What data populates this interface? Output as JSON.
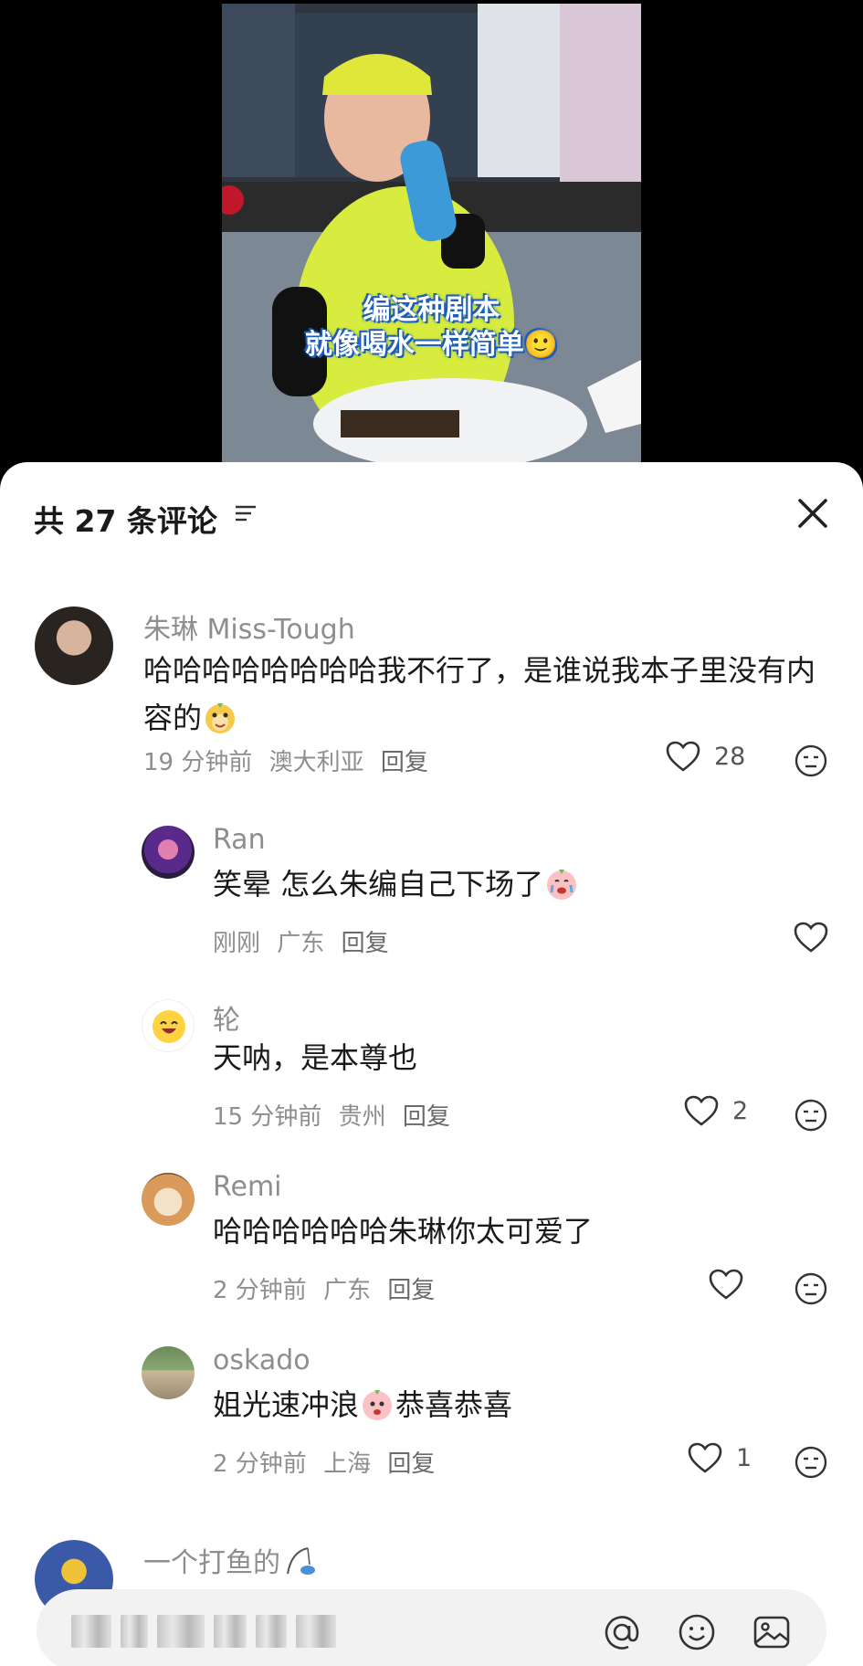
{
  "video": {
    "caption_line1": "编这种剧本",
    "caption_line2": "就像喝水一样简单🙂"
  },
  "header": {
    "title": "共 27 条评论"
  },
  "comments": [
    {
      "username": "朱琳 Miss-Tough",
      "text": "哈哈哈哈哈哈哈哈我不行了，是谁说我本子里没有内容的",
      "time": "19 分钟前",
      "location": "澳大利亚",
      "reply_label": "回复",
      "likes": "28"
    },
    {
      "username": "Ran",
      "text": "笑晕 怎么朱编自己下场了",
      "time": "刚刚",
      "location": "广东",
      "reply_label": "回复",
      "likes": ""
    },
    {
      "username": "轮",
      "text": "天呐，是本尊也",
      "time": "15 分钟前",
      "location": "贵州",
      "reply_label": "回复",
      "likes": "2"
    },
    {
      "username": "Remi",
      "text": "哈哈哈哈哈哈朱琳你太可爱了",
      "time": "2 分钟前",
      "location": "广东",
      "reply_label": "回复",
      "likes": ""
    },
    {
      "username": "oskado",
      "text_before": "姐光速冲浪",
      "text_after": "恭喜恭喜",
      "time": "2 分钟前",
      "location": "上海",
      "reply_label": "回复",
      "likes": "1"
    },
    {
      "username": "一个打鱼的"
    }
  ],
  "icons": {
    "filter": "filter-icon",
    "close": "close-icon",
    "like": "heart-icon",
    "react": "emoji-react-icon",
    "at": "at-icon",
    "emoji": "smiley-icon",
    "image": "image-icon"
  }
}
